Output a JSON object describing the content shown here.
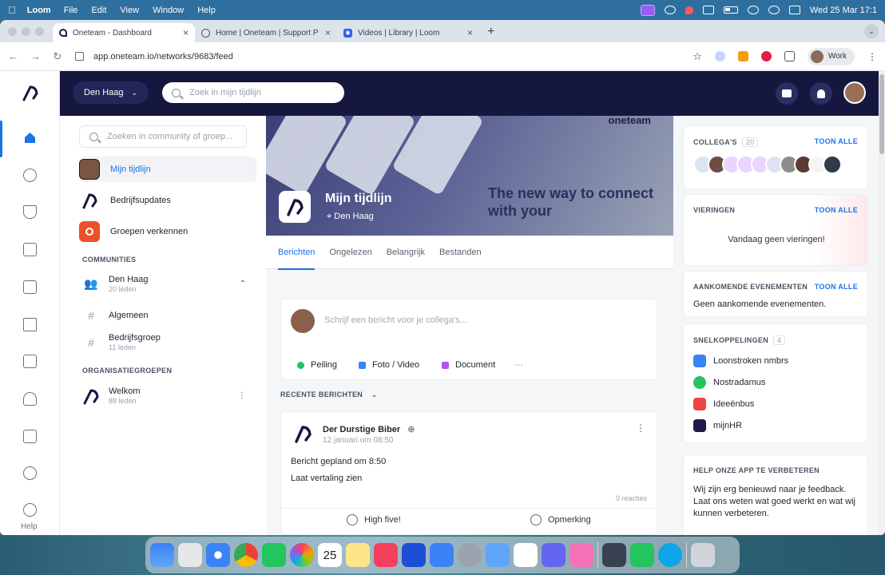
{
  "menubar": {
    "app": "Loom",
    "items": [
      "File",
      "Edit",
      "View",
      "Window",
      "Help"
    ],
    "clock": "Wed 25 Mar  17:1"
  },
  "browser": {
    "tabs": [
      {
        "title": "Oneteam - Dashboard",
        "active": true
      },
      {
        "title": "Home | Oneteam | Support P",
        "active": false
      },
      {
        "title": "Videos | Library | Loom",
        "active": false
      }
    ],
    "url": "app.oneteam.io/networks/9683/feed",
    "profile": "Work"
  },
  "topnav": {
    "location": "Den Haag",
    "search_placeholder": "Zoek in mijn tijdlijn"
  },
  "rail": {
    "help": "Help"
  },
  "leftnav": {
    "search_placeholder": "Zoeken in community of groep...",
    "items": [
      {
        "label": "Mijn tijdlijn"
      },
      {
        "label": "Bedrijfsupdates"
      },
      {
        "label": "Groepen verkennen"
      }
    ],
    "communities_title": "COMMUNITIES",
    "communities": [
      {
        "name": "Den Haag",
        "sub": "20 leden"
      },
      {
        "name": "Algemeen",
        "sub": ""
      },
      {
        "name": "Bedrijfsgroep",
        "sub": "11 leden"
      }
    ],
    "org_title": "ORGANISATIEGROEPEN",
    "org": [
      {
        "name": "Welkom",
        "sub": "88 leden"
      }
    ]
  },
  "main": {
    "banner": {
      "brand": "oneteam",
      "title": "Mijn tijdlijn",
      "location": "Den Haag",
      "slogan": "The new way to connect with your"
    },
    "tabs": [
      "Berichten",
      "Ongelezen",
      "Belangrijk",
      "Bestanden"
    ],
    "composer": {
      "placeholder": "Schrijf een bericht voor je collega's...",
      "buttons": [
        "Peiling",
        "Foto / Video",
        "Document",
        "···"
      ]
    },
    "recent_title": "RECENTE BERICHTEN",
    "post": {
      "author": "Der Durstige Biber",
      "date": "12 januari om 08:50",
      "line1": "Bericht gepland om 8:50",
      "line2": "Laat vertaling zien",
      "reactions": "0 reacties",
      "action1": "High five!",
      "action2": "Opmerking"
    }
  },
  "right": {
    "colleagues": {
      "title": "COLLEGA'S",
      "count": "20",
      "link": "TOON ALLE"
    },
    "celebrations": {
      "title": "VIERINGEN",
      "link": "TOON ALLE",
      "empty": "Vandaag geen vieringen!"
    },
    "events": {
      "title": "AANKOMENDE EVENEMENTEN",
      "link": "TOON ALLE",
      "empty": "Geen aankomende evenementen."
    },
    "shortcuts": {
      "title": "SNELKOPPELINGEN",
      "count": "4",
      "items": [
        {
          "label": "Loonstroken nmbrs",
          "color": "#3b82f6"
        },
        {
          "label": "Nostradamus",
          "color": "#22c55e"
        },
        {
          "label": "Ideeënbus",
          "color": "#ef4444"
        },
        {
          "label": "mijnHR",
          "color": "#1e1b4b"
        }
      ]
    },
    "feedback": {
      "title": "HELP ONZE APP TE VERBETEREN",
      "text": "Wij zijn erg benieuwd naar je feedback. Laat ons weten wat goed werkt en wat wij kunnen verbeteren."
    }
  },
  "dock": {
    "calendar_day": "25"
  }
}
